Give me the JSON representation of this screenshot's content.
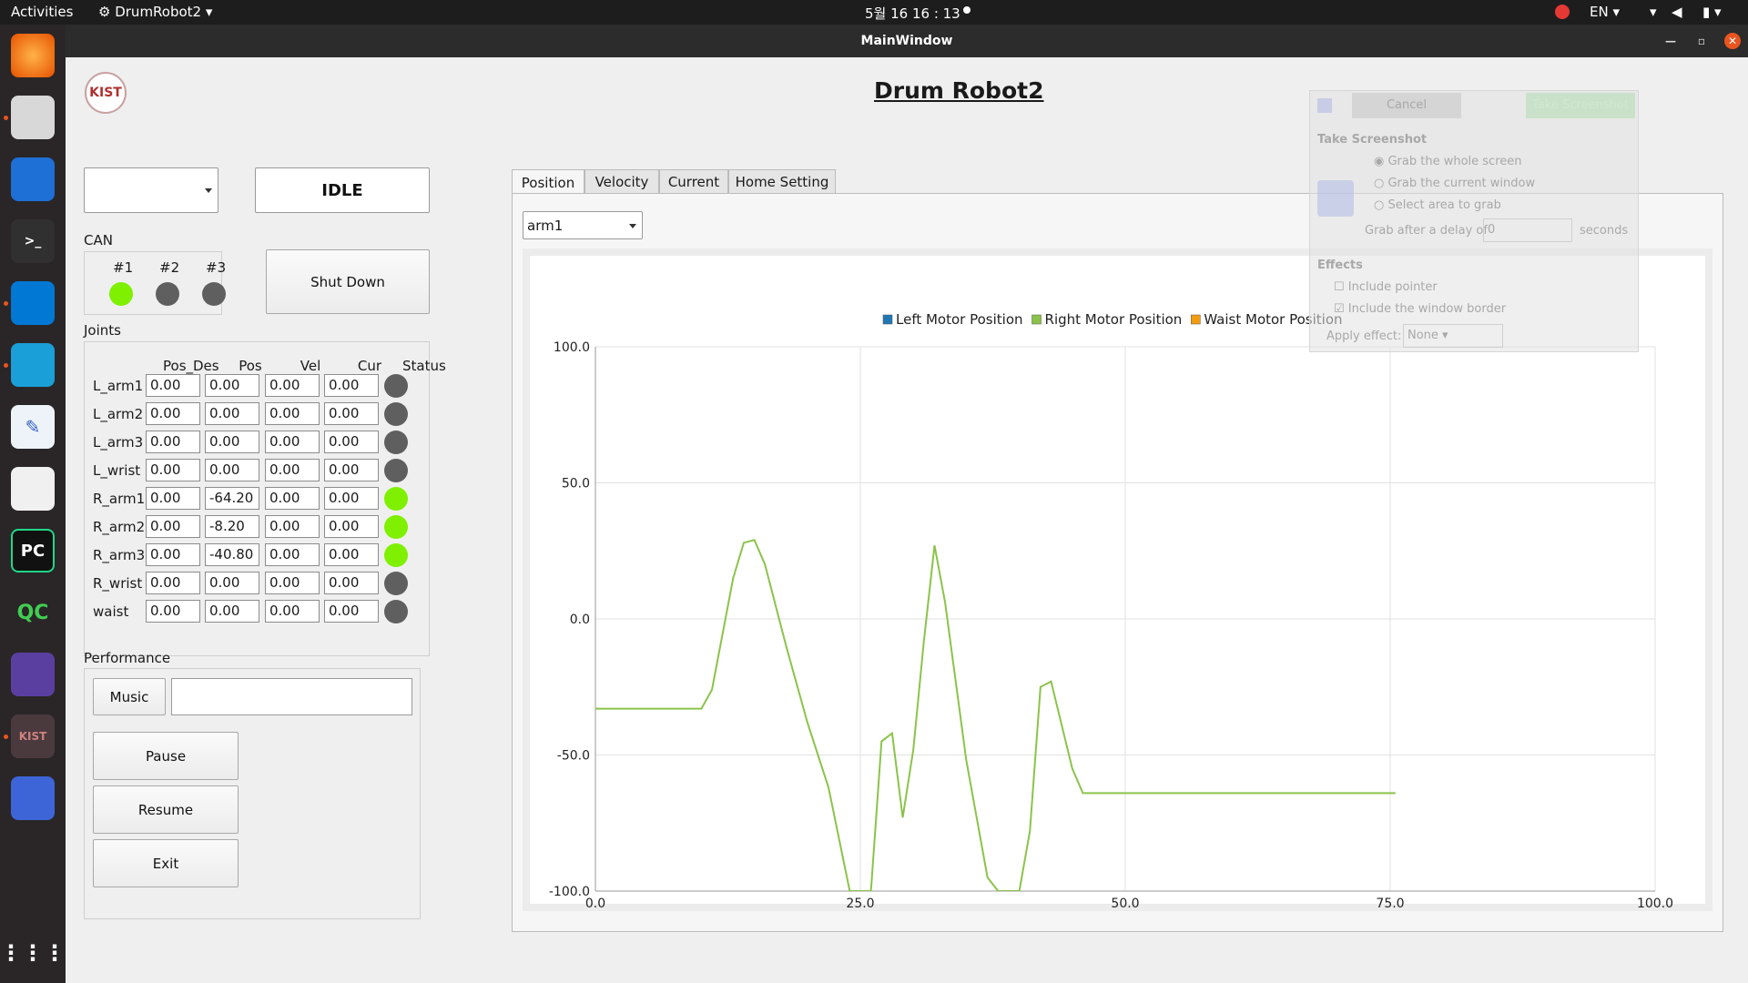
{
  "topbar": {
    "activities": "Activities",
    "app_menu": "DrumRobot2",
    "clock": "5월 16  16 : 13",
    "lang": "EN"
  },
  "window": {
    "title": "MainWindow"
  },
  "app": {
    "title": "Drum Robot2",
    "logo_text": "KIST",
    "state": "IDLE",
    "shutdown_label": "Shut Down"
  },
  "can": {
    "title": "CAN",
    "ports": [
      {
        "label": "#1",
        "status": "green"
      },
      {
        "label": "#2",
        "status": "gray"
      },
      {
        "label": "#3",
        "status": "gray"
      }
    ]
  },
  "joints": {
    "title": "Joints",
    "headers": [
      "Pos_Des",
      "Pos",
      "Vel",
      "Cur",
      "Status"
    ],
    "rows": [
      {
        "name": "L_arm1",
        "pos_des": "0.00",
        "pos": "0.00",
        "vel": "0.00",
        "cur": "0.00",
        "status": "gray"
      },
      {
        "name": "L_arm2",
        "pos_des": "0.00",
        "pos": "0.00",
        "vel": "0.00",
        "cur": "0.00",
        "status": "gray"
      },
      {
        "name": "L_arm3",
        "pos_des": "0.00",
        "pos": "0.00",
        "vel": "0.00",
        "cur": "0.00",
        "status": "gray"
      },
      {
        "name": "L_wrist",
        "pos_des": "0.00",
        "pos": "0.00",
        "vel": "0.00",
        "cur": "0.00",
        "status": "gray"
      },
      {
        "name": "R_arm1",
        "pos_des": "0.00",
        "pos": "-64.20",
        "vel": "0.00",
        "cur": "0.00",
        "status": "green"
      },
      {
        "name": "R_arm2",
        "pos_des": "0.00",
        "pos": "-8.20",
        "vel": "0.00",
        "cur": "0.00",
        "status": "green"
      },
      {
        "name": "R_arm3",
        "pos_des": "0.00",
        "pos": "-40.80",
        "vel": "0.00",
        "cur": "0.00",
        "status": "green"
      },
      {
        "name": "R_wrist",
        "pos_des": "0.00",
        "pos": "0.00",
        "vel": "0.00",
        "cur": "0.00",
        "status": "gray"
      },
      {
        "name": "waist",
        "pos_des": "0.00",
        "pos": "0.00",
        "vel": "0.00",
        "cur": "0.00",
        "status": "gray"
      }
    ]
  },
  "performance": {
    "title": "Performance",
    "music_label": "Music",
    "music_file": "",
    "pause_label": "Pause",
    "resume_label": "Resume",
    "exit_label": "Exit"
  },
  "tabs": [
    "Position",
    "Velocity",
    "Current",
    "Home Setting"
  ],
  "arm_select": "arm1",
  "chart_data": {
    "type": "line",
    "xlim": [
      0,
      100
    ],
    "ylim": [
      -100,
      100
    ],
    "x_ticks": [
      "0.0",
      "25.0",
      "50.0",
      "75.0",
      "100.0"
    ],
    "y_ticks": [
      "100.0",
      "50.0",
      "0.0",
      "-50.0",
      "-100.0"
    ],
    "grid": true,
    "legend_position": "top",
    "series": [
      {
        "name": "Left Motor Position",
        "color": "#1f77b4",
        "x": [],
        "y": []
      },
      {
        "name": "Right Motor Position",
        "color": "#8bc34a",
        "x": [
          0,
          10,
          11,
          13,
          14,
          15,
          16,
          18,
          20,
          22,
          24,
          25,
          26,
          27,
          28,
          29,
          30,
          31,
          32,
          33,
          35,
          37,
          38,
          40,
          41,
          42,
          43,
          45,
          46,
          50,
          60,
          70,
          75.5
        ],
        "y": [
          -33,
          -33,
          -26,
          15,
          28,
          29,
          20,
          -10,
          -38,
          -62,
          -100,
          -100,
          -100,
          -45,
          -42,
          -73,
          -48,
          -8,
          27,
          6,
          -52,
          -95,
          -100,
          -100,
          -78,
          -25,
          -23,
          -55,
          -64,
          -64,
          -64,
          -64,
          -64
        ]
      },
      {
        "name": "Waist Motor Position",
        "color": "#f39c12",
        "x": [],
        "y": []
      }
    ]
  },
  "screenshot_dialog": {
    "cancel": "Cancel",
    "take": "Take Screenshot",
    "heading": "Take Screenshot",
    "opt1": "Grab the whole screen",
    "opt2": "Grab the current window",
    "opt3": "Select area to grab",
    "delay_label": "Grab after a delay of",
    "delay_value": "0",
    "seconds": "seconds",
    "effects": "Effects",
    "pointer": "Include pointer",
    "border": "Include the window border",
    "apply": "Apply effect:",
    "none": "None"
  }
}
